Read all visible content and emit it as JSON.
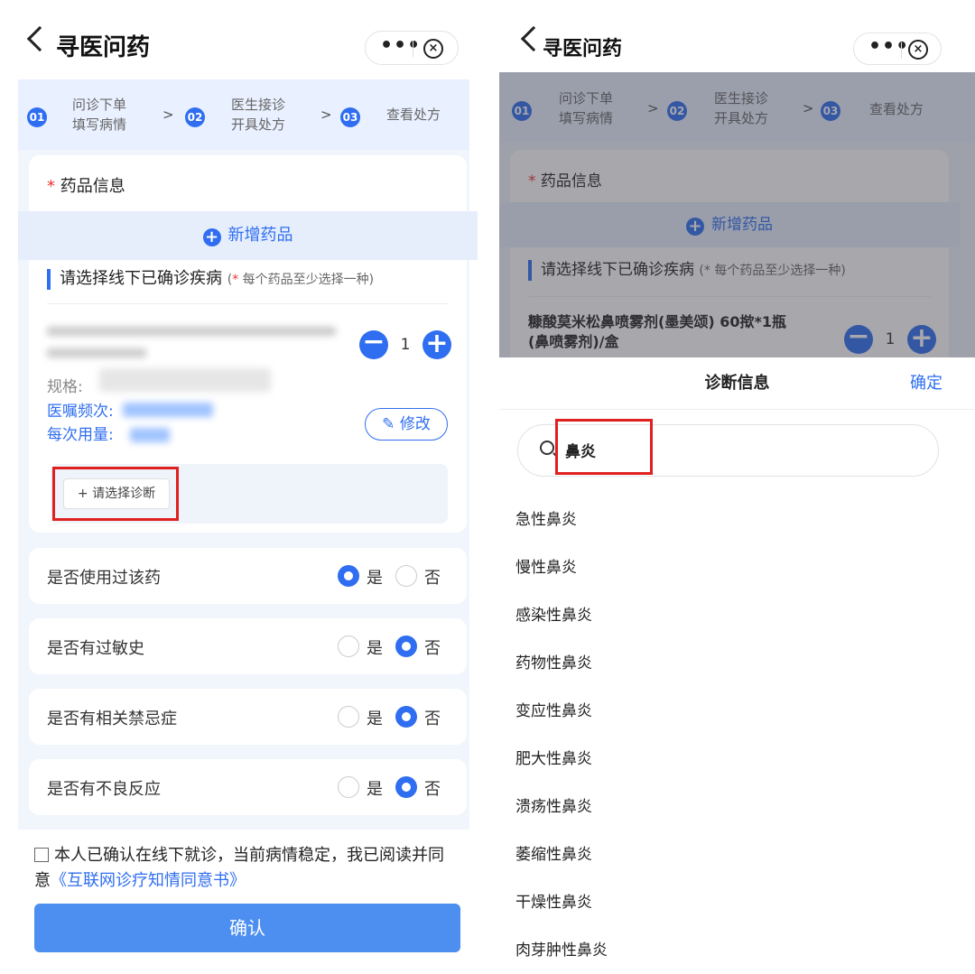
{
  "left": {
    "nav": {
      "title": "寻医问药",
      "more": "•••",
      "close": "⊗"
    },
    "steps": [
      {
        "num": "01",
        "line1": "问诊下单",
        "line2": "填写病情"
      },
      {
        "num": "02",
        "line1": "医生接诊",
        "line2": "开具处方"
      },
      {
        "num": "03",
        "line1": "查看处方",
        "line2": ""
      }
    ],
    "step_arrow": ">",
    "drug_card": {
      "required_mark": "*",
      "heading": "药品信息",
      "add_drug": "新增药品",
      "select_disease": "请选择线下已确诊疾病",
      "select_disease_note_open": "(",
      "select_disease_note_mark": "*",
      "select_disease_note": " 每个药品至少选择一种)",
      "spec_label": "规格:",
      "freq_label": "医嘱频次:",
      "dose_label": "每次用量:",
      "quantity": "1",
      "edit_label": "修改",
      "diagnosis_button": "+ 请选择诊断"
    },
    "questions": [
      {
        "text": "是否使用过该药",
        "yes": "是",
        "no": "否",
        "selected": "yes"
      },
      {
        "text": "是否有过敏史",
        "yes": "是",
        "no": "否",
        "selected": "no"
      },
      {
        "text": "是否有相关禁忌症",
        "yes": "是",
        "no": "否",
        "selected": "no"
      },
      {
        "text": "是否有不良反应",
        "yes": "是",
        "no": "否",
        "selected": "no"
      }
    ],
    "agreement_text": "本人已确认在线下就诊，当前病情稳定，我已阅读并同意",
    "agreement_link": "《互联网诊疗知情同意书》",
    "confirm": "确认"
  },
  "right": {
    "nav": {
      "title": "寻医问药",
      "more": "•••",
      "close": "⊗"
    },
    "drug_name_line1": "糠酸莫米松鼻喷雾剂(墨美颂) 60揿*1瓶",
    "drug_name_line2": "(鼻喷雾剂)/盒",
    "sheet_title": "诊断信息",
    "sheet_confirm": "确定",
    "search_query": "鼻炎",
    "results": [
      "急性鼻炎",
      "慢性鼻炎",
      "感染性鼻炎",
      "药物性鼻炎",
      "变应性鼻炎",
      "肥大性鼻炎",
      "溃疡性鼻炎",
      "萎缩性鼻炎",
      "干燥性鼻炎",
      "肉芽肿性鼻炎"
    ]
  },
  "colors": {
    "accent": "#2f6ef0",
    "highlight_box": "#e02020",
    "step_bg": "#e9f0ff",
    "confirm_button": "#4d8ff0"
  }
}
